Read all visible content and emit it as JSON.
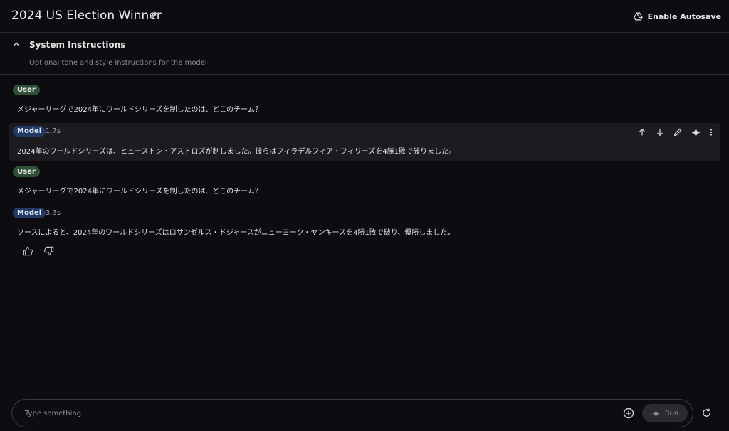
{
  "header": {
    "title": "2024 US Election Winner",
    "edit_icon": "pencil-icon",
    "autosave_label": "Enable Autosave",
    "autosave_icon": "drive-icon"
  },
  "system_instructions": {
    "title": "System Instructions",
    "placeholder": "Optional tone and style instructions for the model",
    "chevron_icon": "chevron-up-icon"
  },
  "messages": [
    {
      "role": "User",
      "text": "メジャーリーグで2024年にワールドシリーズを制したのは、どこのチーム？"
    },
    {
      "role": "Model",
      "duration": "1.7s",
      "text": "2024年のワールドシリーズは、ヒューストン・アストロズが制しました。彼らはフィラデルフィア・フィリーズを4勝1敗で破りました。"
    },
    {
      "role": "User",
      "text": "メジャーリーグで2024年にワールドシリーズを制したのは、どこのチーム？"
    },
    {
      "role": "Model",
      "duration": "3.3s",
      "text": "ソースによると、2024年のワールドシリーズはロサンゼルス・ドジャースがニューヨーク・ヤンキースを4勝1敗で破り、優勝しました。"
    }
  ],
  "message_actions": [
    "arrow-up-icon",
    "arrow-down-icon",
    "pencil-icon",
    "sparkle-icon",
    "more-vert-icon"
  ],
  "feedback": [
    "thumbs-up-icon",
    "thumbs-down-icon"
  ],
  "composer": {
    "placeholder": "Type something",
    "run_label": "Run",
    "add_icon": "add-circle-icon",
    "refresh_icon": "refresh-icon"
  },
  "colors": {
    "background": "#0d0d11",
    "user_badge": "#2f4f36",
    "model_badge": "#223a63",
    "active_message": "#1b1b20"
  }
}
